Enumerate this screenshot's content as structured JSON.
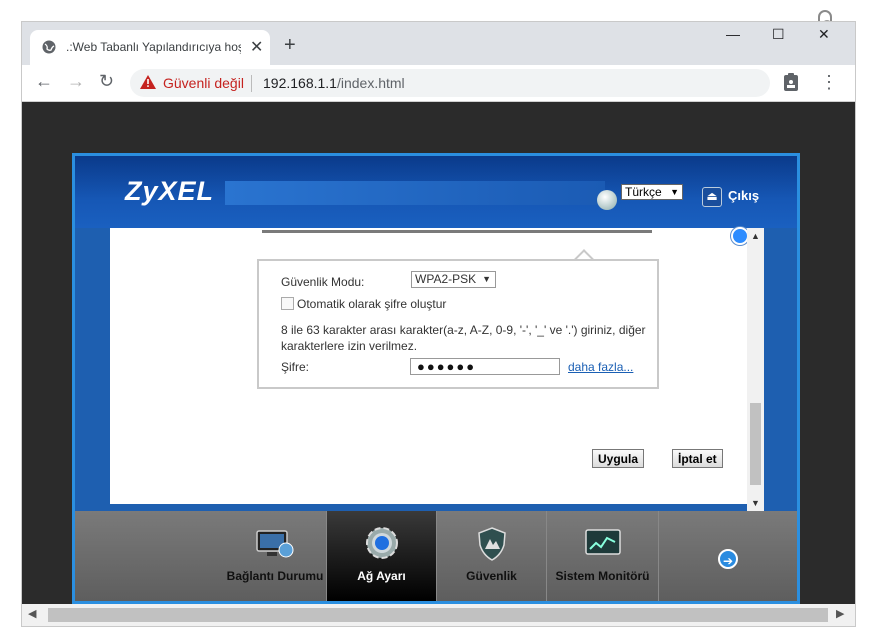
{
  "browser": {
    "tab_title": ".:Web Tabanlı Yapılandırıcıya hoş",
    "tab_close": "✕",
    "new_tab": "+",
    "minimize": "—",
    "maximize": "☐",
    "close": "✕",
    "back": "←",
    "forward": "→",
    "reload": "↻",
    "security_warning": "Güvenli değil",
    "url_host": "192.168.1.1",
    "url_path": "/index.html",
    "menu": "⋮"
  },
  "router": {
    "logo": "ZyXEL",
    "language": "Türkçe",
    "logout": "Çıkış",
    "security_mode_label": "Güvenlik Modu:",
    "security_mode_value": "WPA2-PSK",
    "auto_password_label": "Otomatik olarak şifre oluştur",
    "auto_password_checked": false,
    "hint_line1": "8 ile 63 karakter arası karakter(a-z, A-Z, 0-9, '-', '_' ve '.') giriniz, diğer",
    "hint_line2": "karakterlere izin verilmez.",
    "password_label": "Şifre:",
    "password_value": "●●●●●●",
    "more_link": "daha fazla...",
    "apply_button": "Uygula",
    "cancel_button": "İptal et",
    "nav": [
      {
        "label": "Bağlantı Durumu",
        "icon": "monitor-globe-icon",
        "active": false
      },
      {
        "label": "Ağ Ayarı",
        "icon": "gear-icon",
        "active": true
      },
      {
        "label": "Güvenlik",
        "icon": "shield-icon",
        "active": false
      },
      {
        "label": "Sistem Monitörü",
        "icon": "chart-monitor-icon",
        "active": false
      }
    ],
    "next_arrow": "➔"
  },
  "colors": {
    "accent_blue": "#1a60c0",
    "warning_red": "#c5221f",
    "link_blue": "#1a5fb4"
  }
}
